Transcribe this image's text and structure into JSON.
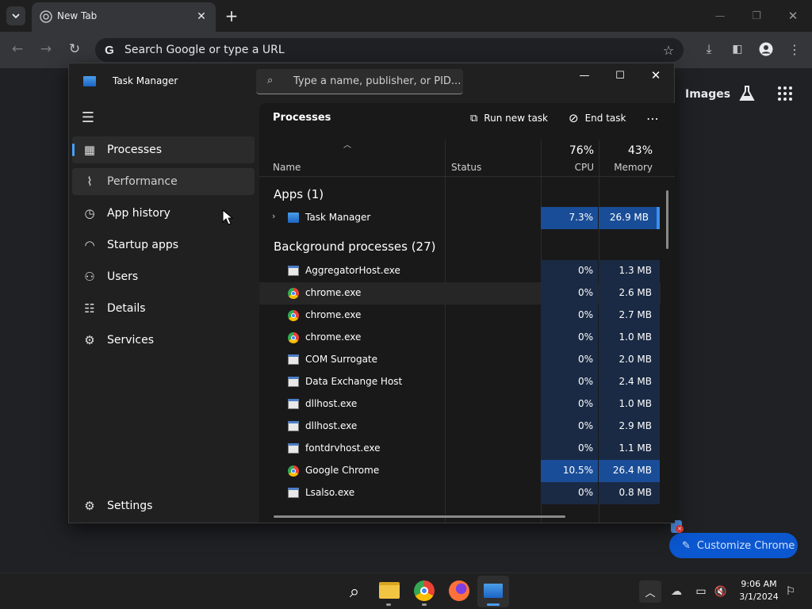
{
  "browser": {
    "tab_title": "New Tab",
    "omnibox_placeholder": "Search Google or type a URL",
    "ntp_images_link": "Images",
    "customize_button": "Customize Chrome"
  },
  "task_manager": {
    "title": "Task Manager",
    "search_placeholder": "Type a name, publisher, or PID...",
    "nav": [
      {
        "label": "Processes",
        "icon": "processes-icon"
      },
      {
        "label": "Performance",
        "icon": "performance-icon"
      },
      {
        "label": "App history",
        "icon": "history-icon"
      },
      {
        "label": "Startup apps",
        "icon": "startup-icon"
      },
      {
        "label": "Users",
        "icon": "users-icon"
      },
      {
        "label": "Details",
        "icon": "details-icon"
      },
      {
        "label": "Services",
        "icon": "services-icon"
      }
    ],
    "settings_label": "Settings",
    "page_title": "Processes",
    "run_new_task": "Run new task",
    "end_task": "End task",
    "columns": {
      "name": "Name",
      "status": "Status",
      "cpu_pct": "76%",
      "cpu": "CPU",
      "mem_pct": "43%",
      "memory": "Memory"
    },
    "apps_group": "Apps (1)",
    "apps": [
      {
        "name": "Task Manager",
        "cpu": "7.3%",
        "memory": "26.9 MB",
        "icon": "taskmanager"
      }
    ],
    "bg_group": "Background processes (27)",
    "processes": [
      {
        "name": "AggregatorHost.exe",
        "cpu": "0%",
        "memory": "1.3 MB",
        "icon": "exe"
      },
      {
        "name": "chrome.exe",
        "cpu": "0%",
        "memory": "2.6 MB",
        "icon": "chrome"
      },
      {
        "name": "chrome.exe",
        "cpu": "0%",
        "memory": "2.7 MB",
        "icon": "chrome"
      },
      {
        "name": "chrome.exe",
        "cpu": "0%",
        "memory": "1.0 MB",
        "icon": "chrome"
      },
      {
        "name": "COM Surrogate",
        "cpu": "0%",
        "memory": "2.0 MB",
        "icon": "exe"
      },
      {
        "name": "Data Exchange Host",
        "cpu": "0%",
        "memory": "2.4 MB",
        "icon": "exe"
      },
      {
        "name": "dllhost.exe",
        "cpu": "0%",
        "memory": "1.0 MB",
        "icon": "exe"
      },
      {
        "name": "dllhost.exe",
        "cpu": "0%",
        "memory": "2.9 MB",
        "icon": "exe"
      },
      {
        "name": "fontdrvhost.exe",
        "cpu": "0%",
        "memory": "1.1 MB",
        "icon": "exe"
      },
      {
        "name": "Google Chrome",
        "cpu": "10.5%",
        "memory": "26.4 MB",
        "icon": "chrome"
      },
      {
        "name": "Lsalso.exe",
        "cpu": "0%",
        "memory": "0.8 MB",
        "icon": "exe"
      }
    ]
  },
  "taskbar": {
    "time": "9:06 AM",
    "date": "3/1/2024"
  },
  "colors": {
    "accent": "#1e5fb4",
    "cell_dark": "#1a2a44",
    "cell_hot": "#1a4d97"
  }
}
